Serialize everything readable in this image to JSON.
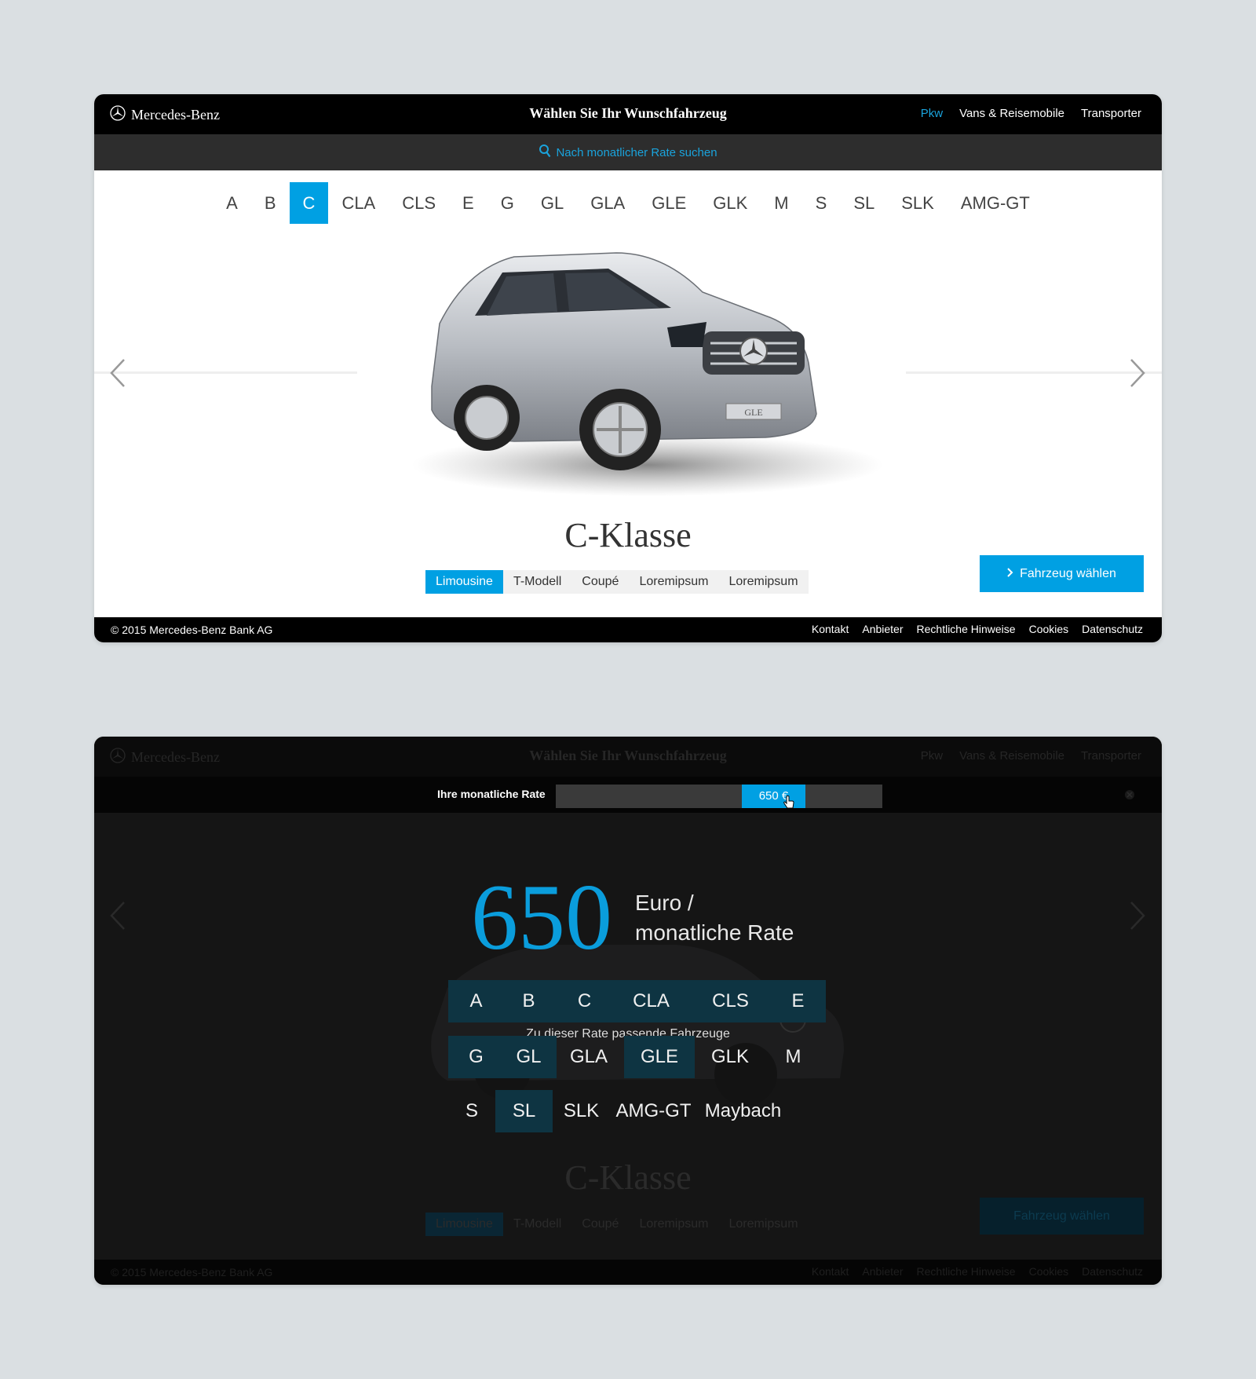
{
  "header": {
    "brand": "Mercedes-Benz",
    "title": "Wählen Sie Ihr Wunschfahrzeug",
    "nav": [
      {
        "label": "Pkw",
        "active": true
      },
      {
        "label": "Vans & Reisemobile",
        "active": false
      },
      {
        "label": "Transporter",
        "active": false
      }
    ]
  },
  "search": {
    "label": "Nach monatlicher Rate suchen"
  },
  "model_letters": [
    "A",
    "B",
    "C",
    "CLA",
    "CLS",
    "E",
    "G",
    "GL",
    "GLA",
    "GLE",
    "GLK",
    "M",
    "S",
    "SL",
    "SLK",
    "AMG-GT"
  ],
  "selected_letter": "C",
  "car": {
    "class_name": "C-Klasse",
    "plate": "GLE"
  },
  "body_types": [
    "Limousine",
    "T-Modell",
    "Coupé",
    "Loremipsum",
    "Loremipsum"
  ],
  "selected_body_type": "Limousine",
  "choose_button": "Fahrzeug wählen",
  "footer": {
    "copyright": "© 2015 Mercedes-Benz Bank AG",
    "links": [
      "Kontakt",
      "Anbieter",
      "Rechtliche Hinweise",
      "Cookies",
      "Datenschutz"
    ]
  },
  "rate_overlay": {
    "label": "Ihre monatliche Rate",
    "slider_value": "650 €",
    "slider_position_percent": 64,
    "big_value": "650",
    "unit_line1": "Euro /",
    "unit_line2": "monatliche Rate",
    "match_title": "Zu dieser Rate passende Fahrzeuge",
    "matches": [
      [
        "A",
        "B",
        "C",
        "CLA",
        "CLS",
        "E"
      ],
      [
        "G",
        "GL",
        "GLA",
        "GLE",
        "GLK",
        "M"
      ],
      [
        "S",
        "SL",
        "SLK",
        "AMG-GT",
        "Maybach"
      ]
    ],
    "highlighted": [
      "A",
      "B",
      "C",
      "CLA",
      "CLS",
      "E",
      "G",
      "GL",
      "GLE",
      "SL"
    ]
  },
  "colors": {
    "accent": "#00a0e3",
    "dark": "#000000",
    "overlay": "#151515",
    "highlight": "#0e3442"
  }
}
